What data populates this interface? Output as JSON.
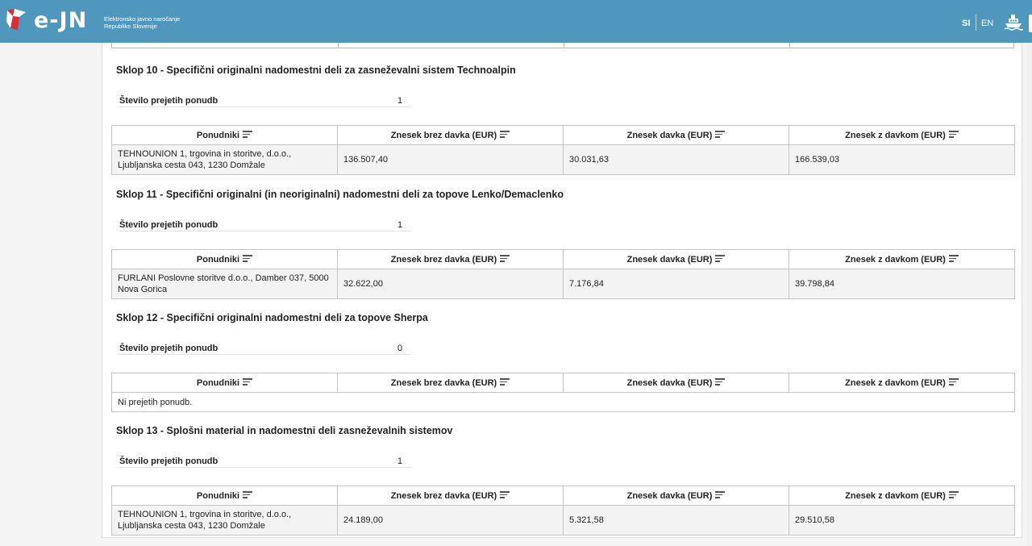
{
  "header": {
    "logo_text": "e-JN",
    "logo_subtitle_line1": "Elektronsko javno naročanje",
    "logo_subtitle_line2": "Republike Slovenije",
    "lang_si": "SI",
    "lang_en": "EN",
    "icons": [
      "logo-mark-icon",
      "ship-icon"
    ],
    "colors": {
      "header_bg": "#4f97bc",
      "logo_red": "#d62f35"
    }
  },
  "table_headers": {
    "bidders": "Ponudniki",
    "amount_without_tax": "Znesek brez davka (EUR)",
    "tax_amount": "Znesek davka (EUR)",
    "amount_with_tax": "Znesek z davkom (EUR)"
  },
  "count_label": "Število prejetih ponudb",
  "empty_text": "Ni prejetih ponudb.",
  "lots": [
    {
      "title": "Sklop 10 - Specifični originalni nadomestni deli za zasneževalni sistem Technoalpin",
      "received_offers": "1",
      "rows": [
        {
          "bidder": "TEHNOUNION 1, trgovina in storitve, d.o.o., Ljubljanska cesta 043, 1230 Domžale",
          "without_tax": "136.507,40",
          "tax": "30.031,63",
          "with_tax": "166.539,03"
        }
      ]
    },
    {
      "title": "Sklop 11 - Specifični originalni (in neoriginalni) nadomestni deli za topove Lenko/Demaclenko",
      "received_offers": "1",
      "rows": [
        {
          "bidder": "FURLANI Poslovne storitve d.o.o., Damber 037, 5000 Nova Gorica",
          "without_tax": "32.622,00",
          "tax": "7.176,84",
          "with_tax": "39.798,84"
        }
      ]
    },
    {
      "title": "Sklop 12 - Specifični originalni nadomestni deli za topove Sherpa",
      "received_offers": "0",
      "rows": []
    },
    {
      "title": "Sklop 13 - Splošni material in nadomestni deli zasneževalnih sistemov",
      "received_offers": "1",
      "rows": [
        {
          "bidder": "TEHNOUNION 1, trgovina in storitve, d.o.o., Ljubljanska cesta 043, 1230 Domžale",
          "without_tax": "24.189,00",
          "tax": "5.321,58",
          "with_tax": "29.510,58"
        }
      ]
    }
  ]
}
